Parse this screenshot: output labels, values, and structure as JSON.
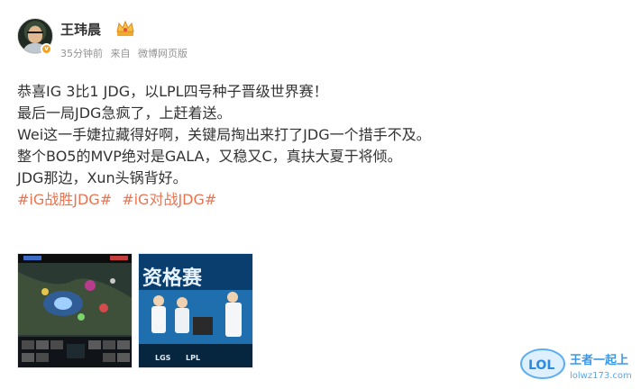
{
  "post": {
    "author": "王玮晨",
    "time": "35分钟前",
    "source_prefix": "来自",
    "source": "微博网页版",
    "lines": [
      "恭喜IG 3比1 JDG，以LPL四号种子晋级世界赛！",
      "最后一局JDG急疯了，上赶着送。",
      "Wei这一手婕拉藏得好啊，关键局掏出来打了JDG一个措手不及。",
      "整个BO5的MVP绝对是GALA，又稳又C，真扶大夏于将倾。",
      "JDG那边，Xun头锅背好。"
    ],
    "hashtags": [
      "#iG战胜JDG#",
      "#iG对战JDG#"
    ]
  },
  "images": {
    "pic2_text": "资格赛",
    "pic2_bottom": [
      "LGS",
      "LPL"
    ]
  },
  "watermark": {
    "logo": "LOL",
    "title": "王者一起上",
    "url": "lolwz173.com"
  },
  "colors": {
    "hashtag": "#eb7350",
    "meta": "#939393"
  }
}
